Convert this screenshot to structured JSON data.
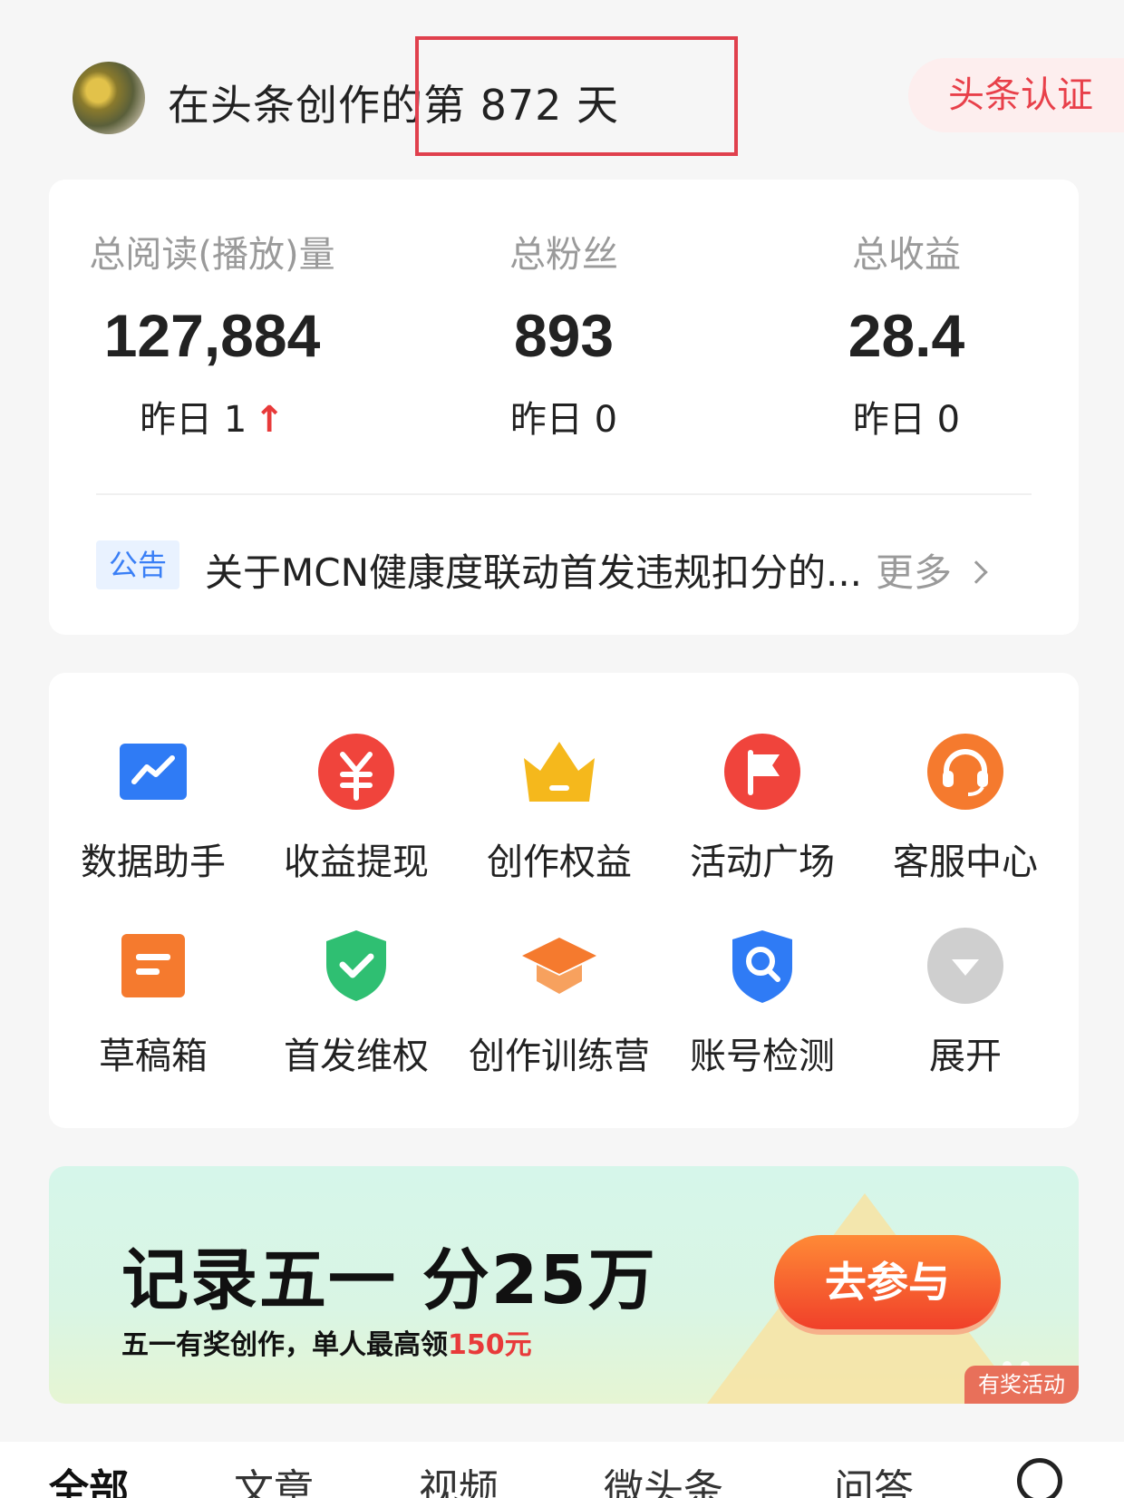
{
  "header": {
    "days_text": "在头条创作的第 872 天",
    "cert_label": "头条认证"
  },
  "stats": [
    {
      "label": "总阅读(播放)量",
      "value": "127,884",
      "delta": "昨日 1",
      "arrow": "↑"
    },
    {
      "label": "总粉丝",
      "value": "893",
      "delta": "昨日 0"
    },
    {
      "label": "总收益",
      "value": "28.4",
      "delta": "昨日 0"
    }
  ],
  "notice": {
    "tag": "公告",
    "text": "关于MCN健康度联动首发违规扣分的...",
    "more": "更多"
  },
  "tools": [
    {
      "label": "数据助手",
      "icon": "chart-icon",
      "color": "#2f7bf5"
    },
    {
      "label": "收益提现",
      "icon": "yuan-icon",
      "color": "#f0443c"
    },
    {
      "label": "创作权益",
      "icon": "crown-icon",
      "color": "#f5b81c"
    },
    {
      "label": "活动广场",
      "icon": "flag-icon",
      "color": "#f0443c"
    },
    {
      "label": "客服中心",
      "icon": "headset-icon",
      "color": "#f57a2e"
    },
    {
      "label": "草稿箱",
      "icon": "draft-icon",
      "color": "#f57a2e"
    },
    {
      "label": "首发维权",
      "icon": "shield-check-icon",
      "color": "#2fbf72"
    },
    {
      "label": "创作训练营",
      "icon": "graduation-cap-icon",
      "color": "#f57a2e"
    },
    {
      "label": "账号检测",
      "icon": "search-shield-icon",
      "color": "#2f7bf5"
    },
    {
      "label": "展开",
      "icon": "expand-icon",
      "color": "#cccccc"
    }
  ],
  "banner": {
    "title": "记录五一 分25万",
    "subtitle_prefix": "五一有奖创作，单人最高领",
    "subtitle_highlight": "150元",
    "button": "去参与",
    "tag": "有奖活动"
  },
  "tabs": [
    "全部",
    "文章",
    "视频",
    "微头条",
    "问答"
  ]
}
